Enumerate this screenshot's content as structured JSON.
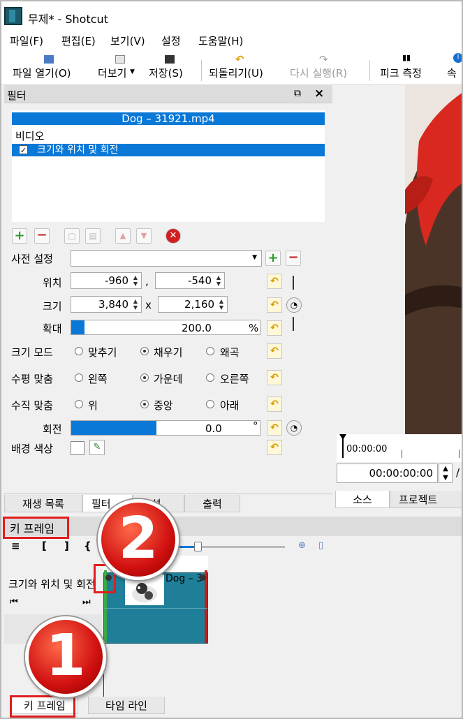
{
  "window": {
    "title": "무제* - Shotcut"
  },
  "menu": [
    "파일(F)",
    "편집(E)",
    "보기(V)",
    "설정",
    "도움말(H)"
  ],
  "toolbar": {
    "open": "파일 열기(O)",
    "more": "더보기",
    "save": "저장(S)",
    "undo": "되돌리기(U)",
    "redo": "다시 실행(R)",
    "peak": "피크 측정",
    "extra": "속"
  },
  "filter": {
    "title": "필터",
    "clip": "Dog – 31921.mp4",
    "category": "비디오",
    "item": "크기와 위치 및 회전",
    "preset_label": "사전 설정",
    "position_label": "위치",
    "pos_x": "-960",
    "pos_sep": ",",
    "pos_y": "-540",
    "size_label": "크기",
    "size_w": "3,840",
    "size_x": "x",
    "size_h": "2,160",
    "zoom_label": "확대",
    "zoom_value": "200.0",
    "zoom_unit": "%",
    "zoom_fill": 0.07,
    "size_mode_label": "크기 모드",
    "size_mode": [
      "맞추기",
      "채우기",
      "왜곡"
    ],
    "size_mode_selected": 1,
    "halign_label": "수평 맞춤",
    "halign": [
      "왼쪽",
      "가운데",
      "오른쪽"
    ],
    "halign_selected": 1,
    "valign_label": "수직 맞춤",
    "valign": [
      "위",
      "중앙",
      "아래"
    ],
    "valign_selected": 1,
    "rotation_label": "회전",
    "rotation_value": "0.0",
    "rotation_unit": "°",
    "rotation_fill": 0.45,
    "bg_label": "배경 색상"
  },
  "left_tabs": [
    "재생 목록",
    "필터",
    "속성",
    "출력"
  ],
  "right": {
    "ruler_time": "00:00:00",
    "timecode": "00:00:00:00",
    "slash": "/",
    "tabs": [
      "소스",
      "프로젝트"
    ]
  },
  "keyframes": {
    "title": "키 프레임",
    "toolbar": [
      "≡",
      "[",
      "]",
      "{"
    ],
    "track_label": "크기와 위치 및 회전",
    "clip_label": "Dog – 3"
  },
  "bottom_tabs": [
    "키 프레임",
    "타임 라인"
  ],
  "badges": [
    "1",
    "2"
  ]
}
